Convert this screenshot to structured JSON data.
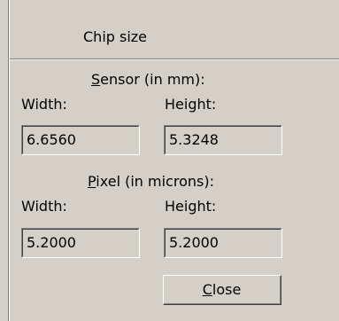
{
  "dialog": {
    "title": "Chip size"
  },
  "sensor": {
    "heading_mnemonic": "S",
    "heading_rest": "ensor (in mm):",
    "width_label": "Width:",
    "height_label": "Height:",
    "width_value": "6.6560",
    "height_value": "5.3248"
  },
  "pixel": {
    "heading_mnemonic": "P",
    "heading_rest": "ixel (in microns):",
    "width_label": "Width:",
    "height_label": "Height:",
    "width_value": "5.2000",
    "height_value": "5.2000"
  },
  "buttons": {
    "close_mnemonic": "C",
    "close_rest": "lose"
  }
}
